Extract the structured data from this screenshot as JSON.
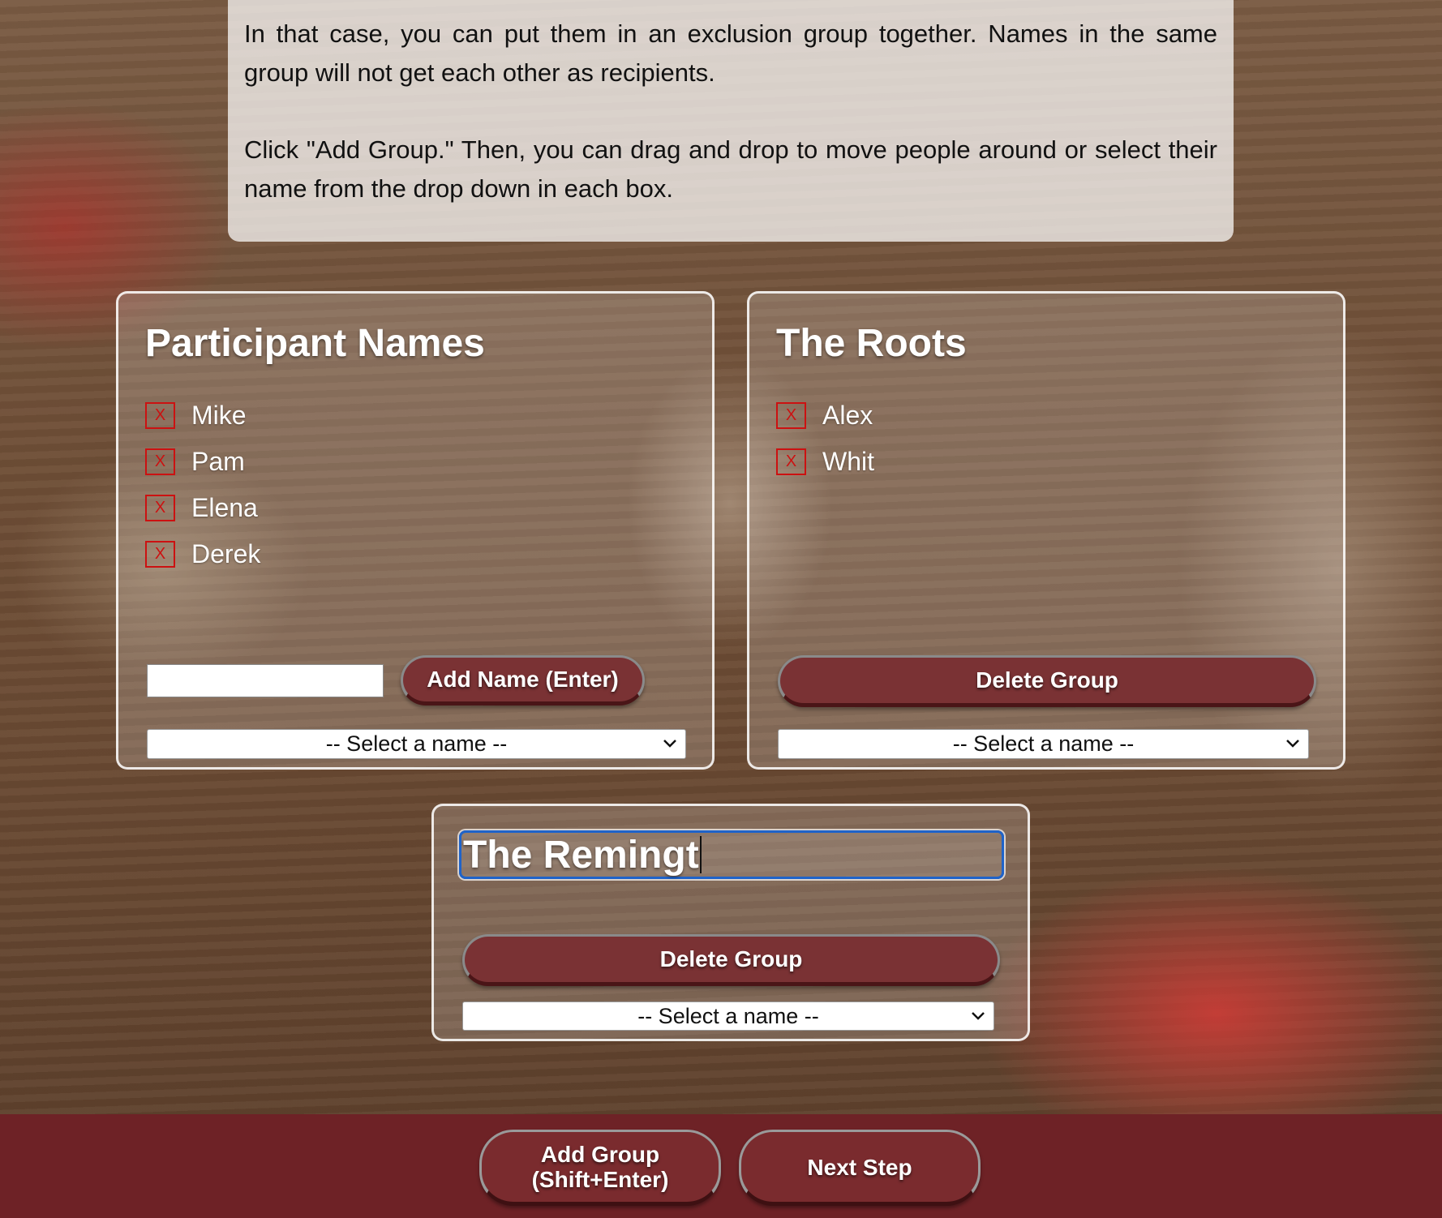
{
  "intro": {
    "paragraph1": "In that case, you can put them in an exclusion group together. Names in the same group will not get each other as recipients.",
    "paragraph2": "Click \"Add Group.\" Then, you can drag and drop to move people around or select their name from the drop down in each box."
  },
  "participants": {
    "title": "Participant Names",
    "remove_symbol": "X",
    "names": [
      "Mike",
      "Pam",
      "Elena",
      "Derek"
    ],
    "input_value": "",
    "add_button": "Add Name (Enter)",
    "select_value": "-- Select a name --"
  },
  "group1": {
    "title": "The Roots",
    "remove_symbol": "X",
    "names": [
      "Alex",
      "Whit"
    ],
    "delete_button": "Delete Group",
    "select_value": "-- Select a name --"
  },
  "group2": {
    "title_input_value": "The Remingt",
    "delete_button": "Delete Group",
    "select_value": "-- Select a name --"
  },
  "footer": {
    "add_group_line1": "Add Group",
    "add_group_line2": "(Shift+Enter)",
    "next_step": "Next Step"
  },
  "colors": {
    "button": "#7a3234",
    "footer": "#6e2226",
    "remove_x": "#cc1111",
    "focus_ring": "#1f63c9"
  },
  "icons": {
    "remove": "close-icon",
    "dropdown": "chevron-down-icon"
  }
}
